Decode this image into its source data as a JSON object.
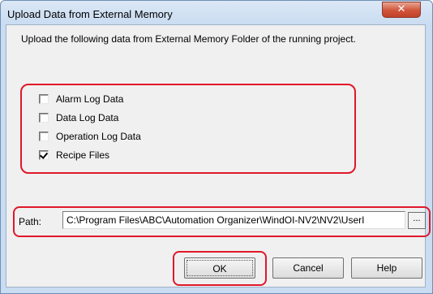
{
  "window": {
    "title": "Upload Data from External Memory",
    "close_glyph": "✕"
  },
  "description": "Upload the following data from External Memory Folder of the running project.",
  "options": [
    {
      "label": "Alarm Log Data",
      "checked": false
    },
    {
      "label": "Data Log Data",
      "checked": false
    },
    {
      "label": "Operation Log Data",
      "checked": false
    },
    {
      "label": "Recipe Files",
      "checked": true
    }
  ],
  "path": {
    "label": "Path:",
    "value": "C:\\Program Files\\ABC\\Automation Organizer\\WindOI-NV2\\NV2\\UserI",
    "browse_label": "..."
  },
  "buttons": {
    "ok": "OK",
    "cancel": "Cancel",
    "help": "Help"
  },
  "colors": {
    "highlight": "#e0182a",
    "face": "#f0f0f0",
    "titlebar": "#c9dcf1"
  }
}
